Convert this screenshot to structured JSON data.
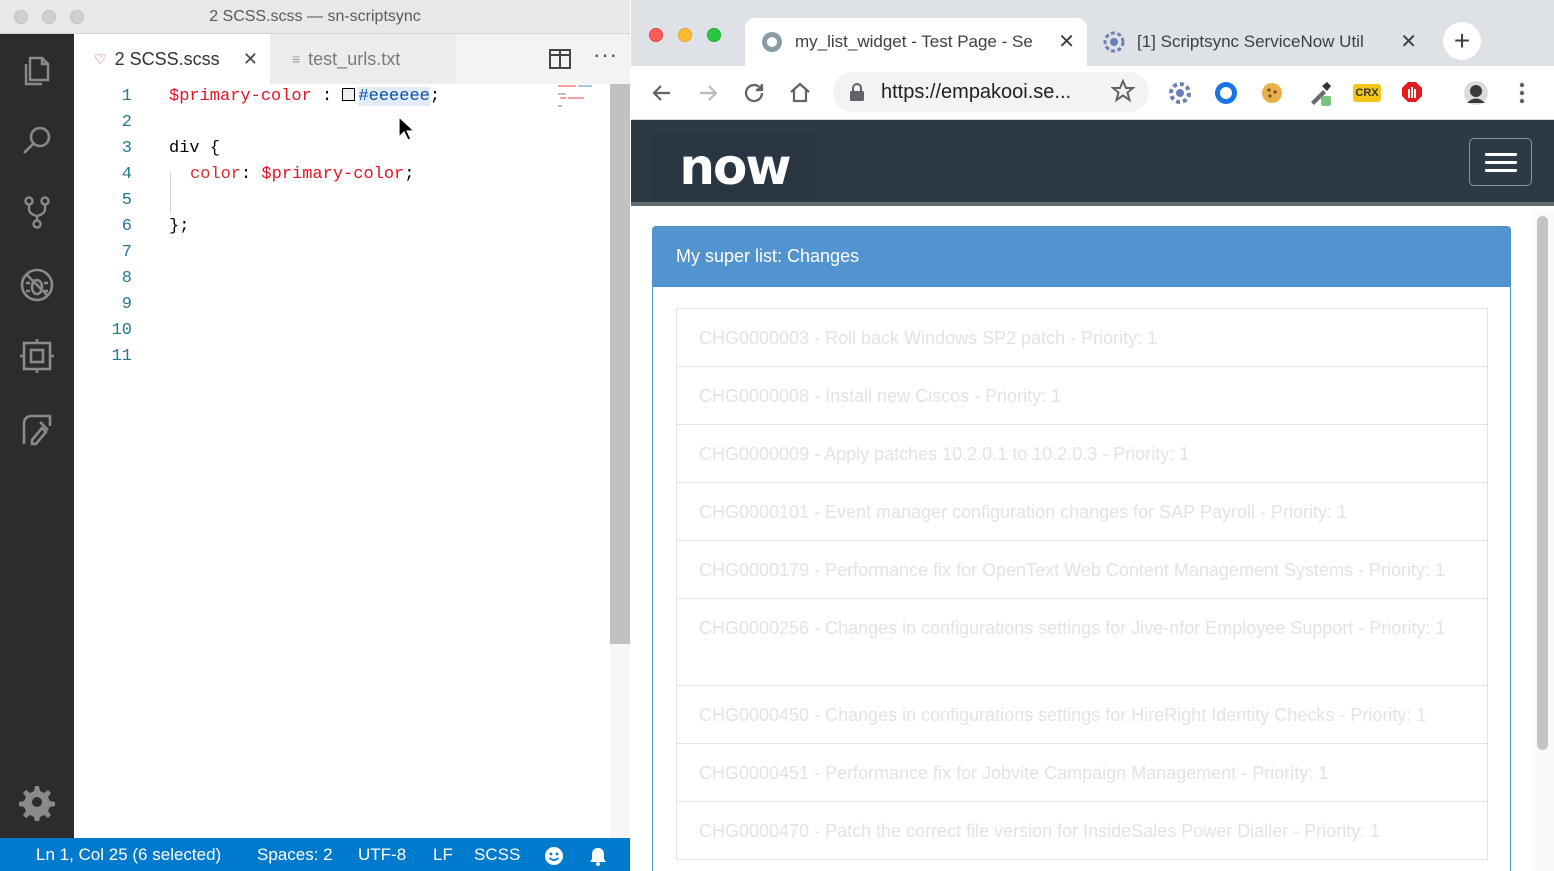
{
  "vscode": {
    "window_title": "2 SCSS.scss — sn-scriptsync",
    "tabs": [
      {
        "label": "2 SCSS.scss",
        "close": "✕"
      },
      {
        "label": "test_urls.txt"
      }
    ],
    "more_actions": "···",
    "line_numbers": [
      "1",
      "2",
      "3",
      "4",
      "5",
      "6",
      "7",
      "8",
      "9",
      "10",
      "11"
    ],
    "code": {
      "l1_var": "$primary-color",
      "l1_sep": " : ",
      "l1_value": "#eeeeee",
      "l1_end": ";",
      "l3": "div {",
      "l4_prop": "color",
      "l4_sep": ": ",
      "l4_var": "$primary-color",
      "l4_end": ";",
      "l6": "};"
    },
    "status": {
      "position": "Ln 1, Col 25 (6 selected)",
      "spaces": "Spaces: 2",
      "encoding": "UTF-8",
      "eol": "LF",
      "language": "SCSS"
    }
  },
  "chrome": {
    "tabs": [
      {
        "title": "my_list_widget - Test Page - Se",
        "close": "✕"
      },
      {
        "title": "[1] Scriptsync ServiceNow Util",
        "close": "✕"
      }
    ],
    "new_tab": "+",
    "url": "https://empakooi.se...",
    "extensions": [
      "gear-extension",
      "circle-extension",
      "cookie-extension",
      "eyedropper-extension",
      "crx-extension",
      "stop-hand-extension",
      "profile-avatar"
    ],
    "crx_label": "CRX"
  },
  "page": {
    "logo_text": "now",
    "panel_title": "My super list: Changes",
    "items": [
      "CHG0000003 - Roll back Windows SP2 patch - Priority: 1",
      "CHG0000008 - Install new Ciscos - Priority: 1",
      "CHG0000009 - Apply patches 10.2.0.1 to 10.2.0.3 - Priority: 1",
      "CHG0000101 - Event manager configuration changes for SAP Payroll - Priority: 1",
      "CHG0000179 - Performance fix for OpenText Web Content Management Systems - Priority: 1",
      "CHG0000256 - Changes in configurations settings for Jive-nfor Employee Support - Priority: 1",
      "CHG0000450 - Changes in configurations settings for HireRight Identity Checks - Priority: 1",
      "CHG0000451 - Performance fix for Jobvite Campaign Management - Priority: 1",
      "CHG0000470 - Patch the correct file version for InsideSales Power Dialler - Priority: 1"
    ]
  },
  "colors": {
    "statusbar": "#007acc",
    "panel_header": "#5294cf",
    "navbar": "#2d3a45",
    "scss_variable": "#e81123",
    "list_text": "#e3e3e3"
  }
}
